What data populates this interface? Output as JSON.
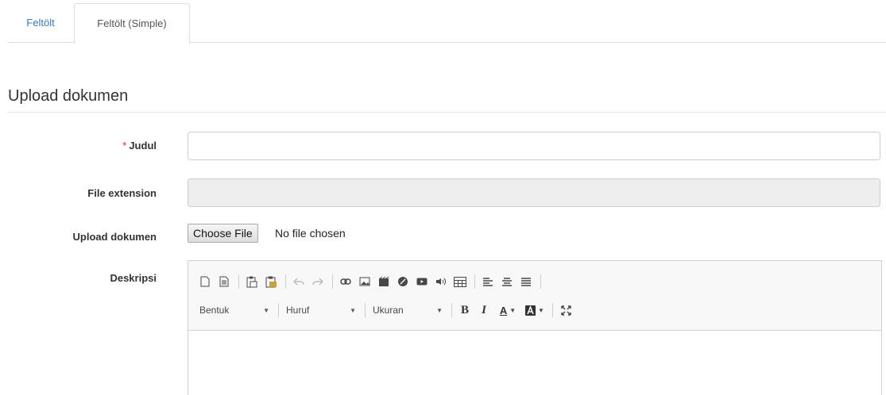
{
  "tabs": [
    {
      "label": "Feltölt",
      "active": false
    },
    {
      "label": "Feltölt (Simple)",
      "active": true
    }
  ],
  "section": {
    "title": "Upload dokumen"
  },
  "form": {
    "judul": {
      "label": "Judul",
      "required_mark": "*",
      "value": ""
    },
    "file_extension": {
      "label": "File extension",
      "value": "",
      "disabled": true
    },
    "upload": {
      "label": "Upload dokumen",
      "button": "Choose File",
      "status": "No file chosen"
    },
    "deskripsi": {
      "label": "Deskripsi"
    }
  },
  "editor": {
    "row1_icons": [
      "new-page-icon",
      "preview-icon",
      "paste-icon",
      "paste-word-icon",
      "undo-icon",
      "redo-icon",
      "link-icon",
      "image-icon",
      "flash-icon",
      "iframe-icon",
      "youtube-icon",
      "audio-icon",
      "table-icon",
      "align-left-icon",
      "align-center-icon",
      "justify-icon"
    ],
    "combos": {
      "format": "Bentuk",
      "font": "Huruf",
      "size": "Ukuran"
    },
    "row2_icons": [
      "bold-icon",
      "italic-icon",
      "text-color-icon",
      "bg-color-icon",
      "maximize-icon"
    ],
    "bold_glyph": "B",
    "italic_glyph": "I",
    "text_color_glyph": "A"
  },
  "colors": {
    "link": "#3a7ab8",
    "required": "#c9302c",
    "disabled_bg": "#eeeeee"
  }
}
